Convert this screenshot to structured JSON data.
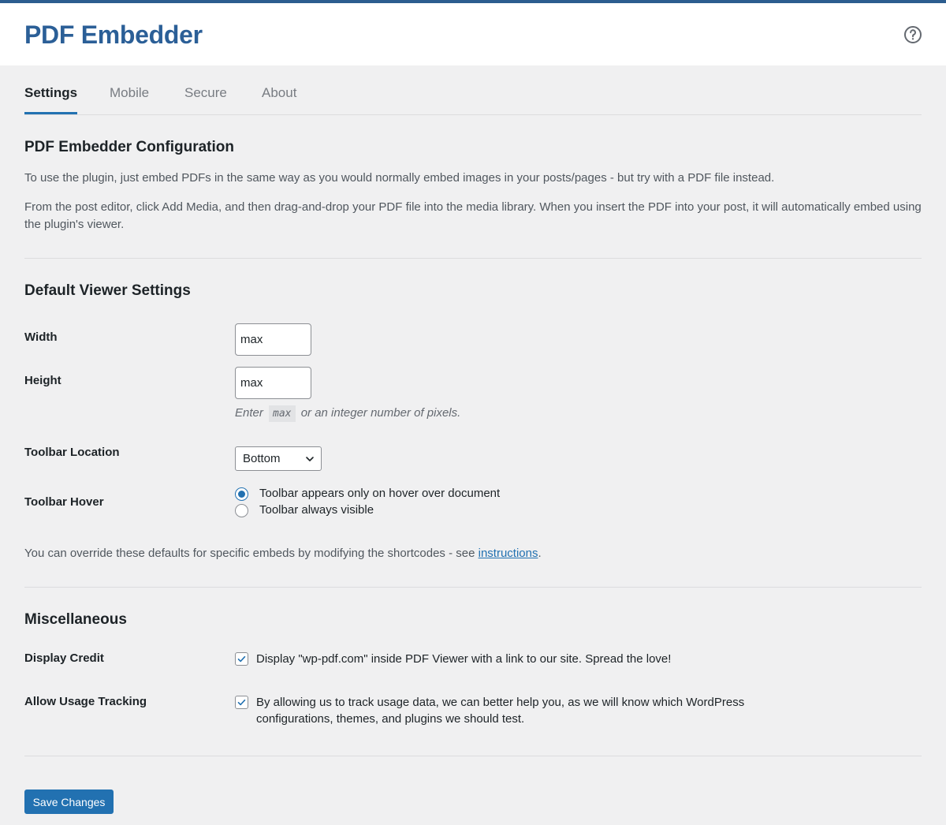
{
  "header": {
    "title": "PDF Embedder",
    "help_icon": "question-circle-icon"
  },
  "tabs": [
    {
      "label": "Settings",
      "active": true
    },
    {
      "label": "Mobile",
      "active": false
    },
    {
      "label": "Secure",
      "active": false
    },
    {
      "label": "About",
      "active": false
    }
  ],
  "config": {
    "heading": "PDF Embedder Configuration",
    "para1": "To use the plugin, just embed PDFs in the same way as you would normally embed images in your posts/pages - but try with a PDF file instead.",
    "para2": "From the post editor, click Add Media, and then drag-and-drop your PDF file into the media library. When you insert the PDF into your post, it will automatically embed using the plugin's viewer."
  },
  "viewer": {
    "heading": "Default Viewer Settings",
    "width_label": "Width",
    "width_value": "max",
    "height_label": "Height",
    "height_value": "max",
    "hint_before": "Enter",
    "hint_code": "max",
    "hint_after": "or an integer number of pixels.",
    "toolbar_location_label": "Toolbar Location",
    "toolbar_location_value": "Bottom",
    "toolbar_hover_label": "Toolbar Hover",
    "hover_options": [
      {
        "label": "Toolbar appears only on hover over document",
        "checked": true
      },
      {
        "label": "Toolbar always visible",
        "checked": false
      }
    ],
    "override_text": "You can override these defaults for specific embeds by modifying the shortcodes - see",
    "override_link": "instructions",
    "override_end": "."
  },
  "misc": {
    "heading": "Miscellaneous",
    "credit_label": "Display Credit",
    "credit_text": "Display \"wp-pdf.com\" inside PDF Viewer with a link to our site. Spread the love!",
    "credit_checked": true,
    "tracking_label": "Allow Usage Tracking",
    "tracking_text": "By allowing us to track usage data, we can better help you, as we will know which WordPress configurations, themes, and plugins we should test.",
    "tracking_checked": true
  },
  "actions": {
    "save_label": "Save Changes"
  },
  "colors": {
    "accent": "#2271b1",
    "brand": "#2b5f97"
  }
}
